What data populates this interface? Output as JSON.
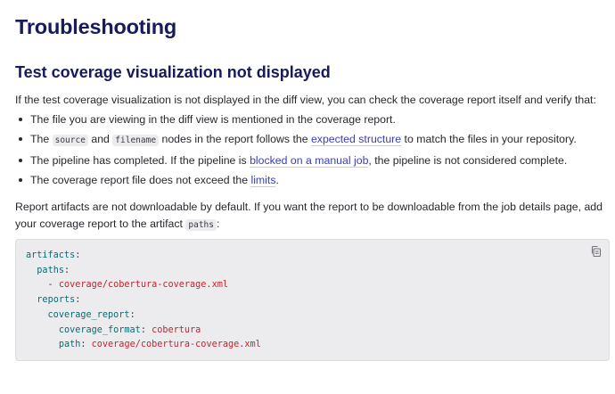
{
  "heading": "Troubleshooting",
  "subheading": "Test coverage visualization not displayed",
  "intro": "If the test coverage visualization is not displayed in the diff view, you can check the coverage report itself and verify that:",
  "bullets": {
    "b1": "The file you are viewing in the diff view is mentioned in the coverage report.",
    "b2": {
      "t1": "The ",
      "c1": "source",
      "t2": " and ",
      "c2": "filename",
      "t3": " nodes in the report follows the ",
      "link": "expected structure",
      "t4": " to match the files in your repository."
    },
    "b3": {
      "t1": "The pipeline has completed. If the pipeline is ",
      "link": "blocked on a manual job",
      "t2": ", the pipeline is not considered complete."
    },
    "b4": {
      "t1": "The coverage report file does not exceed the ",
      "link": "limits",
      "t2": "."
    }
  },
  "note": {
    "t1": "Report artifacts are not downloadable by default. If you want the report to be downloadable from the job details page, add your coverage report to the artifact ",
    "code": "paths",
    "t2": ":"
  },
  "code": {
    "l1_key": "artifacts",
    "l2_key": "paths",
    "l3_item": "coverage/cobertura-coverage.xml",
    "l4_key": "reports",
    "l5_key": "coverage_report",
    "l6_key": "coverage_format",
    "l6_val": "cobertura",
    "l7_key": "path",
    "l7_val": "coverage/cobertura-coverage.xml"
  },
  "icons": {
    "copy": "copy-icon"
  },
  "colors": {
    "heading": "#171a5c",
    "link": "#3a3cbb",
    "yaml_key": "#0b6b6f",
    "yaml_value": "#c0262e",
    "code_bg": "#ececef"
  }
}
